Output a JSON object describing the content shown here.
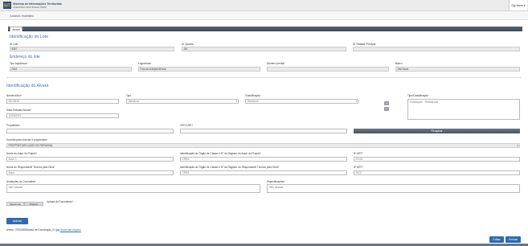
{
  "header": {
    "logo_line1": "Sistema de Informações Territoriais",
    "logo_line2": "CADASTRO MULTIFINALITÁRIO",
    "user_menu": "Sig Nave ▾"
  },
  "breadcrumb": "Cadastro Imobiliário",
  "tab_label": "Alvará",
  "lote": {
    "title": "Identificação do Lote",
    "id_lote_label": "ID Lote",
    "id_lote_value": "8307",
    "id_quadra_label": "ID Quadra",
    "id_quadra_value": "281",
    "id_testada_label": "ID Testada Principal",
    "id_testada_value": ""
  },
  "endereco": {
    "title": "Endereço do lote",
    "tipo_logradouro_label": "Tipo logradouro",
    "tipo_logradouro_value": "RUA",
    "logradouro_label": "Logradouro",
    "logradouro_value": "Rua da Independência",
    "numero_predial_label": "Número predial",
    "numero_predial_value": "",
    "bairro_label": "Bairro",
    "bairro_value": "Vila Nova"
  },
  "alvara": {
    "title": "Identificação do Alvará",
    "numero_ano_label": "Número/Ano",
    "numero_ano_value": "001/2019",
    "tipo_label": "Tipo",
    "tipo_value": "Selecione",
    "classificacao_label": "Classificação",
    "classificacao_value": "Selecione",
    "tipo_classificacao_label": "Tipo/Classificação",
    "tipo_classificacao_value": "Construção - Residencial",
    "data_emissao_label": "Data Emissão Alvará",
    "data_emissao_value": "10/03/2019",
    "proprietario_label": "Proprietário",
    "proprietario_value": "",
    "cpf_cnpj_label": "CPF/CNPJ",
    "cpf_cnpj_value": "",
    "pesquisar_label": "Pesquisar",
    "escolha_label": "Escolha para vincular o proprietário",
    "escolha_value": "PROPRIETÁRIO (NÃO SE REPASSA)",
    "autor_nome_label": "Nome do Autor do Projeto",
    "autor_nome_value": "Autor 1",
    "autor_orgao_label": "Identificação do Órgão de Classe e Nº do Registro do Autor do Projeto",
    "autor_orgao_value": "CREA",
    "autor_art_label": "Nº ART",
    "autor_art_value": "00100",
    "resp_nome_label": "Nome do Responsável Técnico pela Obra",
    "resp_nome_value": "Autor",
    "resp_orgao_label": "Identificação do Órgão de Classe e Nº do Registro do Responsável Técnico pela Obra",
    "resp_orgao_value": "CREA",
    "resp_art_label": "Nº ART",
    "resp_art_value": "0012",
    "anotacoes_label": "Anotações do Concedido",
    "anotacoes_value": "Sem alvarás",
    "especificacoes_label": "Especificações",
    "especificacoes_value": "Sem alvarás"
  },
  "upload": {
    "file_button": "Selecionar",
    "browse_button": "Arquivo",
    "doc_label": "Upload do Documento",
    "upload_button": "Upload",
    "anexo_prefix": "Anexo:",
    "anexo_file": "37540005Alvará de Construção_01.jpg",
    "anexo_link": "Download Arquivo"
  },
  "actions": {
    "edit": "Editar",
    "close": "Fechar"
  }
}
